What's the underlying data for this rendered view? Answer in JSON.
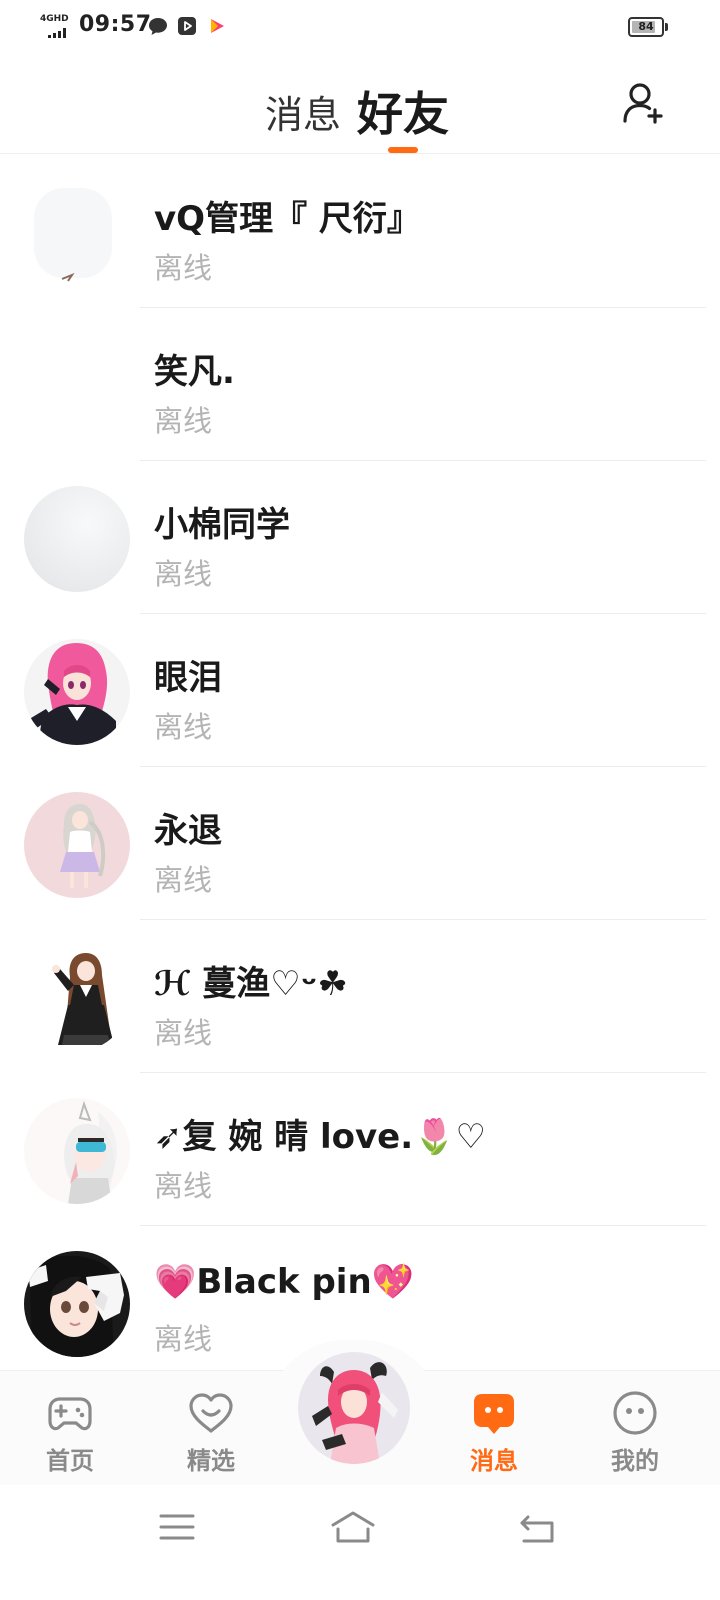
{
  "status_bar": {
    "network": "4GHD",
    "time": "09:57",
    "battery_percent": 84,
    "battery_label": "84",
    "apps": [
      "chat-bubble-icon",
      "play-box-icon",
      "video-play-icon"
    ]
  },
  "header": {
    "tabs": [
      {
        "label": "消息",
        "active": false
      },
      {
        "label": "好友",
        "active": true
      }
    ],
    "accent_color": "#ff6a13",
    "add_friend_icon": "add-user-icon"
  },
  "friends": [
    {
      "name": "vQ管理『 尺衍』",
      "status": "离线"
    },
    {
      "name": "笑凡.",
      "status": "离线"
    },
    {
      "name": "小棉同学",
      "status": "离线"
    },
    {
      "name": "眼泪",
      "status": "离线"
    },
    {
      "name": "永退",
      "status": "离线"
    },
    {
      "name": "ℋ 蔓渔♡ᵕ☘",
      "status": "离线"
    },
    {
      "name": "➶复 婉 晴 love.🌷♡",
      "status": "离线"
    },
    {
      "name": "💗Black pin💖",
      "status": "离线"
    }
  ],
  "bottom_nav": {
    "items": [
      {
        "label": "首页",
        "icon": "gamepad-icon",
        "active": false
      },
      {
        "label": "精选",
        "icon": "heart-icon",
        "active": false
      },
      {
        "label": "消息",
        "icon": "message-icon",
        "active": true
      },
      {
        "label": "我的",
        "icon": "face-icon",
        "active": false
      }
    ],
    "center_icon": "avatar-icon",
    "inactive_color": "#8a8a8a",
    "active_color": "#ff6a13"
  },
  "system_nav": {
    "icons": [
      "menu-icon",
      "home-icon",
      "back-icon"
    ]
  }
}
